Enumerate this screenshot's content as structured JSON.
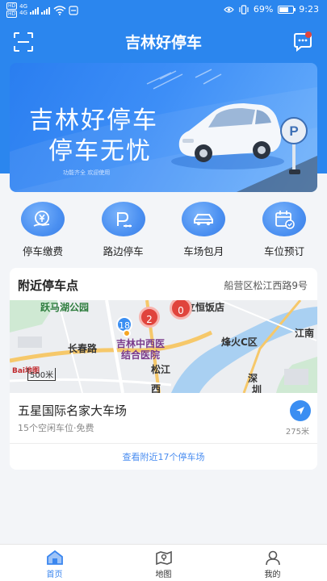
{
  "status_bar": {
    "sim1": "HD",
    "sim2": "HD",
    "network1": "4G",
    "network2": "4G",
    "battery_percent": "69%",
    "battery_level": 0.69,
    "time": "9:23"
  },
  "header": {
    "title": "吉林好停车",
    "left_icon": "scan-icon",
    "right_icon": "message-icon"
  },
  "banner": {
    "title_line1": "吉林好停车",
    "title_line2": "停车无忧",
    "subtitle": "功能齐全  欢迎使用"
  },
  "quick_entries": [
    {
      "label": "停车缴费",
      "icon": "payment-icon"
    },
    {
      "label": "路边停车",
      "icon": "roadside-parking-icon"
    },
    {
      "label": "车场包月",
      "icon": "car-icon"
    },
    {
      "label": "车位预订",
      "icon": "calendar-check-icon"
    }
  ],
  "nearby": {
    "title": "附近停车点",
    "location": "船营区松江西路9号",
    "map": {
      "labels": {
        "park": "跃马湖公园",
        "hotel": "立恒饭店",
        "road": "长春路",
        "hospital1": "吉林中西医",
        "hospital2": "结合医院",
        "river": "松江",
        "district": "烽火C区",
        "jiangnan": "江南",
        "scale": "500米",
        "baidu": "Bai地图",
        "west": "西",
        "shen": "深",
        "zhen": "圳"
      },
      "markers": [
        "18",
        "2",
        "0"
      ]
    },
    "lot": {
      "name": "五星国际名家大车场",
      "info": "15个空闲车位·免费",
      "distance": "275米"
    },
    "view_more": "查看附近17个停车场"
  },
  "bottom_nav": [
    {
      "label": "首页",
      "icon": "home-icon",
      "active": true
    },
    {
      "label": "地图",
      "icon": "map-icon",
      "active": false
    },
    {
      "label": "我的",
      "icon": "user-icon",
      "active": false
    }
  ],
  "colors": {
    "primary": "#2b86ee",
    "accent_blue": "#3a8ef2",
    "marker_red": "#e0443c",
    "background": "#f3f5f8"
  }
}
